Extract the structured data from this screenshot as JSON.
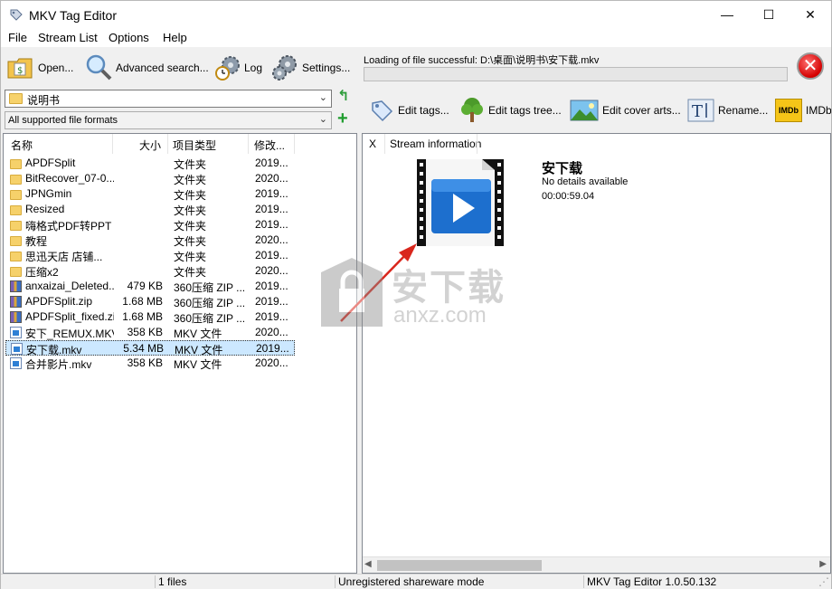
{
  "window": {
    "title": "MKV Tag Editor",
    "minimize": "—",
    "maximize": "☐",
    "close": "✕"
  },
  "menu": [
    "File",
    "Stream List",
    "Options",
    "Help"
  ],
  "left_toolbar": {
    "open": "Open...",
    "advanced_search": "Advanced search...",
    "log": "Log",
    "settings": "Settings..."
  },
  "path": {
    "value": "说明书",
    "arrow": "⌄"
  },
  "filter": {
    "value": "All supported file formats",
    "arrow": "⌄"
  },
  "nav": {
    "up": "↰",
    "add": "+"
  },
  "file_list": {
    "columns": [
      "名称",
      "大小",
      "项目类型",
      "修改..."
    ],
    "rows": [
      {
        "name": "APDFSplit",
        "size": "",
        "type": "文件夹",
        "date": "2019...",
        "icon": "folder-icon"
      },
      {
        "name": "BitRecover_07-0...",
        "size": "",
        "type": "文件夹",
        "date": "2020...",
        "icon": "folder-icon"
      },
      {
        "name": "JPNGmin",
        "size": "",
        "type": "文件夹",
        "date": "2019...",
        "icon": "folder-icon"
      },
      {
        "name": "Resized",
        "size": "",
        "type": "文件夹",
        "date": "2019...",
        "icon": "folder-icon"
      },
      {
        "name": "嗨格式PDF转PPT",
        "size": "",
        "type": "文件夹",
        "date": "2019...",
        "icon": "folder-icon"
      },
      {
        "name": "教程",
        "size": "",
        "type": "文件夹",
        "date": "2020...",
        "icon": "folder-icon"
      },
      {
        "name": "思迅天店 店铺...",
        "size": "",
        "type": "文件夹",
        "date": "2019...",
        "icon": "folder-icon"
      },
      {
        "name": "压缩x2",
        "size": "",
        "type": "文件夹",
        "date": "2020...",
        "icon": "folder-icon"
      },
      {
        "name": "anxaizai_Deleted...",
        "size": "479 KB",
        "type": "360压缩 ZIP ...",
        "date": "2019...",
        "icon": "zip-icon"
      },
      {
        "name": "APDFSplit.zip",
        "size": "1.68 MB",
        "type": "360压缩 ZIP ...",
        "date": "2019...",
        "icon": "zip-icon"
      },
      {
        "name": "APDFSplit_fixed.zip",
        "size": "1.68 MB",
        "type": "360压缩 ZIP ...",
        "date": "2019...",
        "icon": "zip-icon"
      },
      {
        "name": "安下_REMUX.MKV",
        "size": "358 KB",
        "type": "MKV 文件",
        "date": "2020...",
        "icon": "mkv-icon"
      },
      {
        "name": "安下载.mkv",
        "size": "5.34 MB",
        "type": "MKV 文件",
        "date": "2019...",
        "icon": "mkv-icon",
        "selected": true
      },
      {
        "name": "合并影片.mkv",
        "size": "358 KB",
        "type": "MKV 文件",
        "date": "2020...",
        "icon": "mkv-icon"
      }
    ]
  },
  "status_message": "Loading of file successful: D:\\桌面\\说明书\\安下载.mkv",
  "progress": 0,
  "stop_glyph": "✕",
  "right_toolbar": {
    "edit_tags": "Edit tags...",
    "edit_tags_tree": "Edit tags tree...",
    "edit_cover_arts": "Edit cover arts...",
    "rename": "Rename...",
    "imdb_badge": "IMDb",
    "imdb": "IMDb"
  },
  "stream": {
    "header_x": "X",
    "header_label": "Stream information",
    "title": "安下载",
    "details": "No details available",
    "duration": "00:00:59.04"
  },
  "watermark": {
    "cn": "安下载",
    "en": "anxz.com"
  },
  "statusbar": {
    "files": "1 files",
    "mode": "Unregistered shareware mode",
    "version": "MKV Tag Editor 1.0.50.132"
  },
  "colors": {
    "selection": "#cce8ff",
    "accent_red": "#d40000",
    "folder": "#f6d16a"
  }
}
